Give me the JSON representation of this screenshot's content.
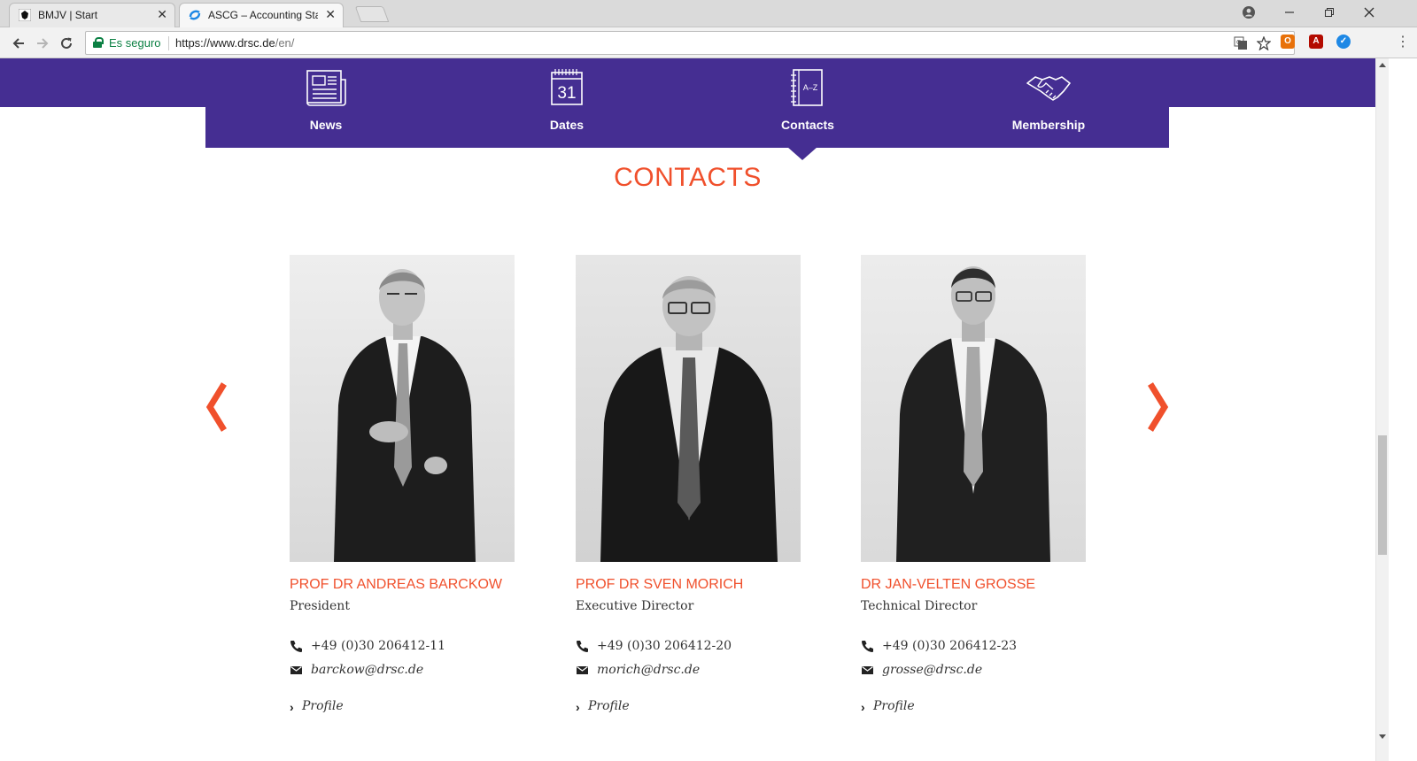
{
  "browser": {
    "tabs": [
      {
        "title": "BMJV | Start",
        "active": false
      },
      {
        "title": "ASCG – Accounting Standards Committee of Germany",
        "active": true
      }
    ],
    "security_label": "Es seguro",
    "url_main": "https://www.drsc.de",
    "url_path": "/en/",
    "close_glyph": "✕"
  },
  "nav": {
    "items": [
      {
        "label": "News",
        "icon": "newspaper-icon"
      },
      {
        "label": "Dates",
        "icon": "calendar-icon",
        "icon_text": "31"
      },
      {
        "label": "Contacts",
        "icon": "address-book-icon",
        "icon_text": "A–Z"
      },
      {
        "label": "Membership",
        "icon": "handshake-icon"
      }
    ],
    "active_index": 2
  },
  "section": {
    "title": "CONTACTS"
  },
  "carousel": {
    "prev_icon": "chevron-left-icon",
    "next_icon": "chevron-right-icon"
  },
  "contacts": [
    {
      "name": "PROF DR ANDREAS BARCKOW",
      "role": "President",
      "phone": "+49 (0)30 206412-11",
      "email": "barckow@drsc.de",
      "profile_label": "Profile"
    },
    {
      "name": "PROF DR SVEN MORICH",
      "role": "Executive Director",
      "phone": "+49 (0)30 206412-20",
      "email": "morich@drsc.de",
      "profile_label": "Profile"
    },
    {
      "name": "DR JAN-VELTEN GROSSE",
      "role": "Technical Director",
      "phone": "+49 (0)30 206412-23",
      "email": "grosse@drsc.de",
      "profile_label": "Profile"
    }
  ],
  "colors": {
    "brand_purple": "#452e92",
    "accent_orange": "#f0502c"
  }
}
